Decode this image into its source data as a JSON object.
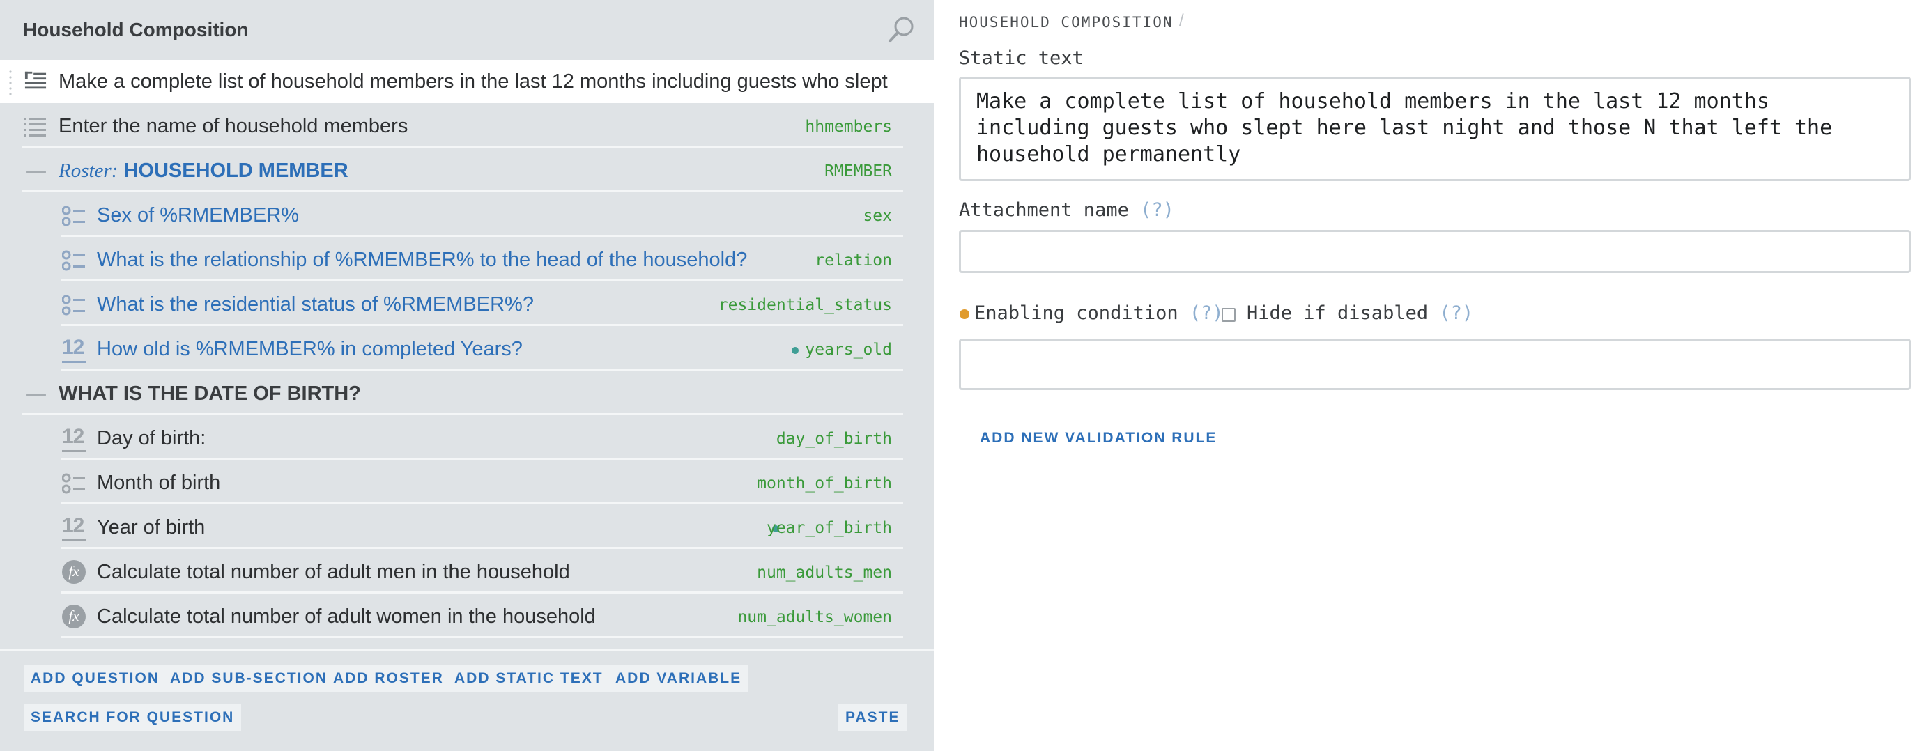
{
  "left_panel": {
    "title": "Household Composition",
    "search_icon": "search-icon",
    "rows": [
      {
        "kind": "static-text",
        "text": "Make a complete list of household members in the last 12 months including guests who slept h",
        "variable": "",
        "selected": true
      },
      {
        "kind": "list-question",
        "text": "Enter the name of household members",
        "variable": "hhmembers"
      },
      {
        "kind": "roster",
        "prefix": "Roster:",
        "text": "HOUSEHOLD MEMBER",
        "variable": "RMEMBER"
      },
      {
        "kind": "single-select",
        "text": "Sex of %RMEMBER%",
        "variable": "sex"
      },
      {
        "kind": "single-select",
        "text": "What is the relationship of %RMEMBER% to the head of the household?",
        "variable": "relation"
      },
      {
        "kind": "single-select",
        "text": "What is the residential status of %RMEMBER%?",
        "variable": "residential_status"
      },
      {
        "kind": "numeric",
        "text": "How old is %RMEMBER% in completed Years?",
        "variable": "years_old"
      },
      {
        "kind": "group",
        "text": "WHAT IS THE DATE OF BIRTH?",
        "variable": ""
      },
      {
        "kind": "numeric",
        "text": "Day of birth:",
        "variable": "day_of_birth"
      },
      {
        "kind": "single-select",
        "text": "Month of birth",
        "variable": "month_of_birth"
      },
      {
        "kind": "numeric",
        "text": "Year of birth",
        "variable": "year_of_birth"
      },
      {
        "kind": "variable",
        "text": "Calculate total number of adult men in the household",
        "variable": "num_adults_men"
      },
      {
        "kind": "variable",
        "text": "Calculate total number of adult women in the household",
        "variable": "num_adults_women"
      }
    ],
    "actions": {
      "add_question": "ADD QUESTION",
      "add_sub_section": "ADD SUB-SECTION",
      "add_roster": "ADD ROSTER",
      "add_static_text": "ADD STATIC TEXT",
      "add_variable": "ADD VARIABLE",
      "search_for_question": "SEARCH FOR QUESTION",
      "paste": "PASTE"
    },
    "icon_glyph_numeric": "12",
    "icon_glyph_variable": "fx"
  },
  "right_panel": {
    "breadcrumb": "HOUSEHOLD COMPOSITION",
    "breadcrumb_separator": "/",
    "static_text_label": "Static text",
    "static_text_value": "Make a complete list of household members in the last 12 months including guests who slept here last night and those N that left the household permanently",
    "attachment_label": "Attachment name",
    "attachment_value": "",
    "help_mark": "(?)",
    "enabling_condition_label": "Enabling condition",
    "enabling_condition_value": "",
    "hide_if_disabled_label": "Hide if disabled",
    "hide_if_disabled_checked": false,
    "add_validation_rule": "ADD NEW VALIDATION RULE"
  },
  "colors": {
    "panel_bg": "#dfe3e6",
    "link_blue": "#2d6fb8",
    "variable_green": "#3a9a3a",
    "condition_dot": "#e09b2d",
    "teal_dot": "#3f9e95"
  }
}
